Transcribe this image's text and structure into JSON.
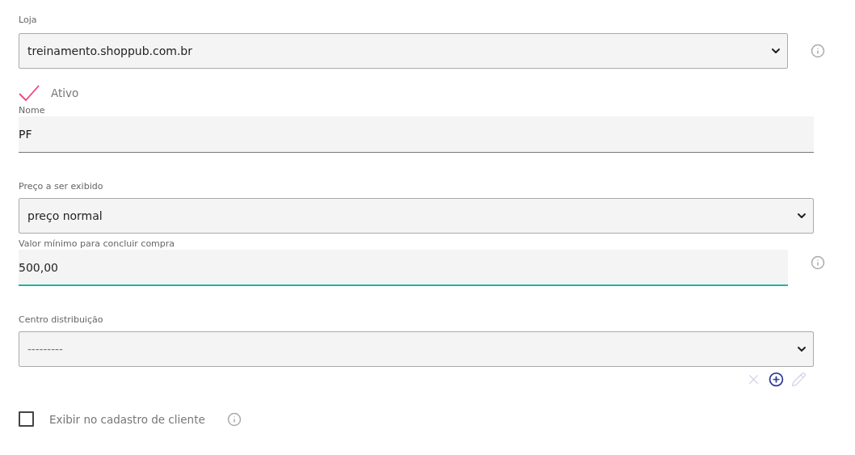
{
  "store": {
    "label": "Loja",
    "value": "treinamento.shoppub.com.br"
  },
  "active": {
    "label": "Ativo",
    "checked": true
  },
  "name_field": {
    "label": "Nome",
    "value": "PF",
    "focused": false
  },
  "price_display": {
    "label": "Preço a ser exibido",
    "value": "preço normal"
  },
  "min_value": {
    "label": "Valor mínimo para concluir compra",
    "value": "500,00",
    "focused": true
  },
  "distribution_center": {
    "label": "Centro distribuição",
    "placeholder": "---------",
    "actions": [
      {
        "kind": "clear",
        "disabled": true
      },
      {
        "kind": "add",
        "disabled": false
      },
      {
        "kind": "edit",
        "disabled": true
      }
    ]
  },
  "show_in_signup": {
    "label": "Exibir no cadastro de cliente",
    "checked": false
  }
}
